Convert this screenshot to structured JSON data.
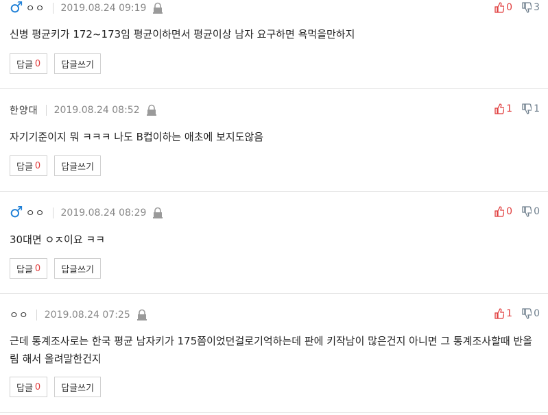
{
  "buttons": {
    "reply_label": "답글",
    "write_reply_label": "답글쓰기"
  },
  "comments": [
    {
      "nick": "ㅇㅇ",
      "male": true,
      "date": "2019.08.24 09:19",
      "text": "신병 평균키가 172~173임 평균이하면서 평균이상 남자 요구하면 욕먹을만하지",
      "up": "0",
      "down": "3",
      "replies": "0"
    },
    {
      "nick": "한양대",
      "male": false,
      "date": "2019.08.24 08:52",
      "text": "자기기준이지 뭐 ㅋㅋㅋ 나도 B컵이하는 애초에 보지도않음",
      "up": "1",
      "down": "1",
      "replies": "0"
    },
    {
      "nick": "ㅇㅇ",
      "male": true,
      "date": "2019.08.24 08:29",
      "text": "30대면 ㅇㅈ이요 ㅋㅋ",
      "up": "0",
      "down": "0",
      "replies": "0"
    },
    {
      "nick": "ㅇㅇ",
      "male": false,
      "date": "2019.08.24 07:25",
      "text": "근데 통계조사로는 한국 평균 남자키가 175쯤이었던걸로기억하는데 판에 키작남이 많은건지 아니면 그 통계조사할때 반올림 해서 올려말한건지",
      "up": "1",
      "down": "0",
      "replies": "0"
    }
  ]
}
